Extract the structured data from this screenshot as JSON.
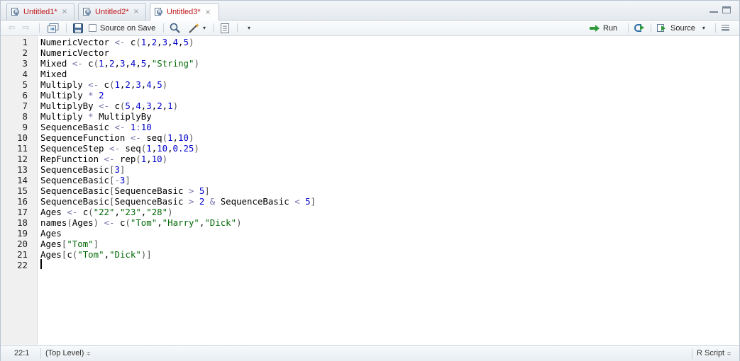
{
  "tabs": [
    {
      "label": "Untitled1*",
      "close": "×"
    },
    {
      "label": "Untitled2*",
      "close": "×"
    },
    {
      "label": "Untitled3*",
      "close": "×"
    }
  ],
  "toolbar": {
    "source_on_save": "Source on Save",
    "run": "Run",
    "source": "Source",
    "caret": "▾"
  },
  "code_lines": [
    {
      "n": "1",
      "t": "NumericVector <- c(1,2,3,4,5)"
    },
    {
      "n": "2",
      "t": "NumericVector"
    },
    {
      "n": "3",
      "t": "Mixed <- c(1,2,3,4,5,\"String\")"
    },
    {
      "n": "4",
      "t": "Mixed"
    },
    {
      "n": "5",
      "t": "Multiply <- c(1,2,3,4,5)"
    },
    {
      "n": "6",
      "t": "Multiply * 2"
    },
    {
      "n": "7",
      "t": "MultiplyBy <- c(5,4,3,2,1)"
    },
    {
      "n": "8",
      "t": "Multiply * MultiplyBy"
    },
    {
      "n": "9",
      "t": "SequenceBasic <- 1:10"
    },
    {
      "n": "10",
      "t": "SequenceFunction <- seq(1,10)"
    },
    {
      "n": "11",
      "t": "SequenceStep <- seq(1,10,0.25)"
    },
    {
      "n": "12",
      "t": "RepFunction <- rep(1,10)"
    },
    {
      "n": "13",
      "t": "SequenceBasic[3]"
    },
    {
      "n": "14",
      "t": "SequenceBasic[-3]"
    },
    {
      "n": "15",
      "t": "SequenceBasic[SequenceBasic > 5]"
    },
    {
      "n": "16",
      "t": "SequenceBasic[SequenceBasic > 2 & SequenceBasic < 5]"
    },
    {
      "n": "17",
      "t": "Ages <- c(\"22\",\"23\",\"28\")"
    },
    {
      "n": "18",
      "t": "names(Ages) <- c(\"Tom\",\"Harry\",\"Dick\")"
    },
    {
      "n": "19",
      "t": "Ages"
    },
    {
      "n": "20",
      "t": "Ages[\"Tom\"]"
    },
    {
      "n": "21",
      "t": "Ages[c(\"Tom\",\"Dick\")]"
    },
    {
      "n": "22",
      "t": ""
    }
  ],
  "status": {
    "position": "22:1",
    "scope": "(Top Level)",
    "file_type": "R Script",
    "updown": "≑"
  },
  "colors": {
    "tab_text": "#c0171a",
    "operator": "#7070a8",
    "number": "#0000cc",
    "string": "#036a07",
    "bracket": "#555555",
    "run_green": "#2f9a3c"
  },
  "icons": [
    "r-file-icon",
    "back-arrow-icon",
    "forward-arrow-icon",
    "show-in-window-icon",
    "save-icon",
    "search-icon",
    "code-tools-wand-icon",
    "compile-notebook-icon",
    "rerun-icon",
    "source-icon",
    "outline-icon"
  ]
}
